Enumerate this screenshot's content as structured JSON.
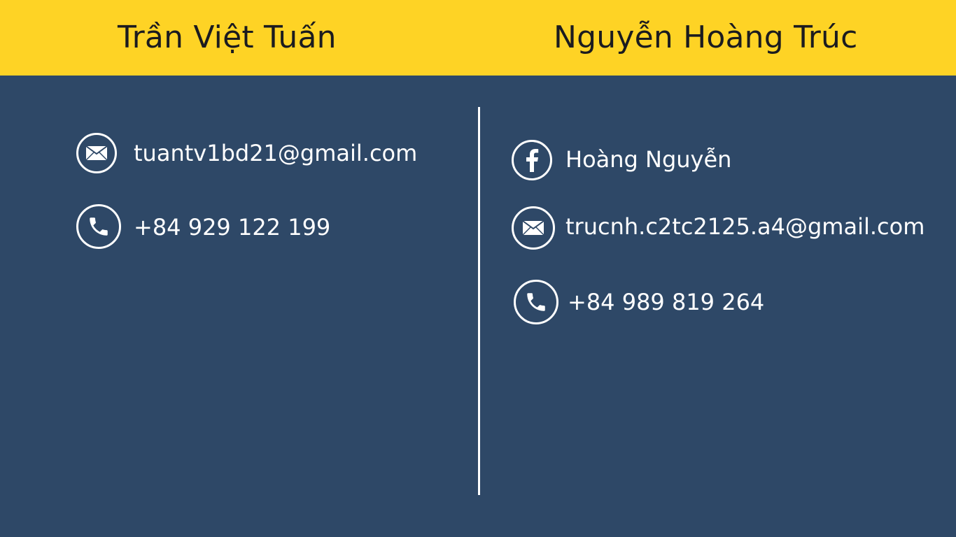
{
  "colors": {
    "header_bg": "#fed325",
    "body_bg": "#2e4867",
    "text_dark": "#1b1b1f",
    "text_light": "#ffffff"
  },
  "left": {
    "name": "Trần Việt Tuấn",
    "contacts": [
      {
        "icon": "envelope-icon",
        "text": "tuantv1bd21@gmail.com"
      },
      {
        "icon": "phone-icon",
        "text": "+84 929 122 199"
      }
    ]
  },
  "right": {
    "name": "Nguyễn Hoàng Trúc",
    "contacts": [
      {
        "icon": "facebook-icon",
        "text": "Hoàng Nguyễn"
      },
      {
        "icon": "envelope-icon",
        "text": "trucnh.c2tc2125.a4@gmail.com"
      },
      {
        "icon": "phone-icon",
        "text": "+84 989 819 264"
      }
    ]
  }
}
